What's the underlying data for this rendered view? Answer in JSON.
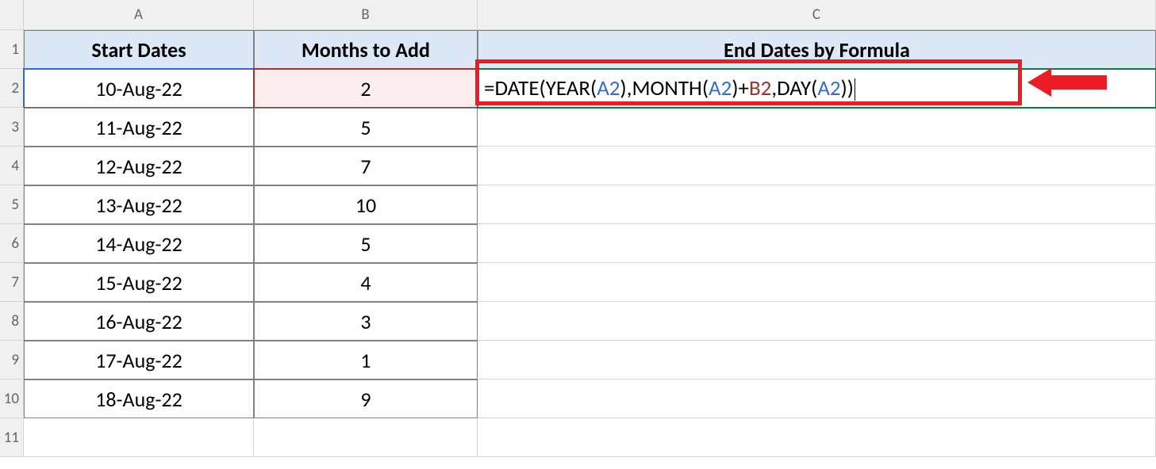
{
  "columns": {
    "A": "A",
    "B": "B",
    "C": "C"
  },
  "rowNumbers": [
    "1",
    "2",
    "3",
    "4",
    "5",
    "6",
    "7",
    "8",
    "9",
    "10",
    "11"
  ],
  "headers": {
    "A": "Start Dates",
    "B": "Months to Add",
    "C": "End Dates by Formula"
  },
  "rows": [
    {
      "A": "10-Aug-22",
      "B": "2"
    },
    {
      "A": "11-Aug-22",
      "B": "5"
    },
    {
      "A": "12-Aug-22",
      "B": "7"
    },
    {
      "A": "13-Aug-22",
      "B": "10"
    },
    {
      "A": "14-Aug-22",
      "B": "5"
    },
    {
      "A": "15-Aug-22",
      "B": "4"
    },
    {
      "A": "16-Aug-22",
      "B": "3"
    },
    {
      "A": "17-Aug-22",
      "B": "1"
    },
    {
      "A": "18-Aug-22",
      "B": "9"
    }
  ],
  "formula": {
    "prefix": "=DATE(YEAR(",
    "ref1": "A2",
    "mid1": "),MONTH(",
    "ref2": "A2",
    "mid2": ")+",
    "ref3": "B2",
    "mid3": ",DAY(",
    "ref4": "A2",
    "suffix": "))"
  }
}
